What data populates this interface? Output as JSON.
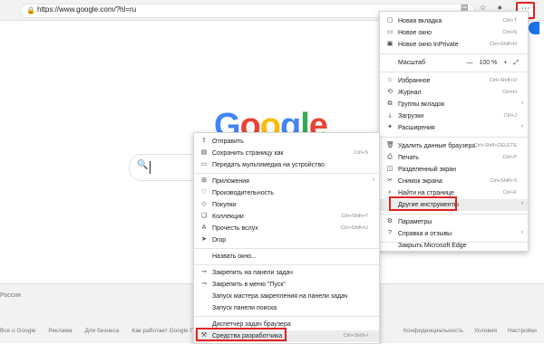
{
  "browser": {
    "url": "https://www.google.com/?hl=ru"
  },
  "page": {
    "logo": "Google",
    "footer_country": "Россия",
    "footer_links_left": [
      "Все о Google",
      "Реклама",
      "Для бизнеса",
      "Как работает Google Поиск"
    ],
    "footer_links_right": [
      "Конфиденциальность",
      "Условия",
      "Настройки"
    ]
  },
  "main_menu": {
    "items": [
      {
        "label": "Новая вкладка",
        "shortcut": "Ctrl+T",
        "icon": "new-tab-icon"
      },
      {
        "label": "Новое окно",
        "shortcut": "Ctrl+N",
        "icon": "new-window-icon"
      },
      {
        "label": "Новое окно InPrivate",
        "shortcut": "Ctrl+Shift+N",
        "icon": "inprivate-icon"
      },
      {
        "label": "Масштаб",
        "icon": "",
        "zoom": {
          "minus": "—",
          "value": "100 %",
          "plus": "+",
          "full": "⤢"
        }
      },
      {
        "label": "Избранное",
        "shortcut": "Ctrl+Shift+O",
        "icon": "star-icon"
      },
      {
        "label": "Журнал",
        "shortcut": "Ctrl+H",
        "icon": "history-icon"
      },
      {
        "label": "Группы вкладок",
        "shortcut": "",
        "icon": "tab-groups-icon",
        "arrow": "›"
      },
      {
        "label": "Загрузки",
        "shortcut": "Ctrl+J",
        "icon": "download-icon"
      },
      {
        "label": "Расширения",
        "shortcut": "",
        "icon": "extensions-icon",
        "arrow": "›"
      },
      {
        "label": "Удалить данные браузера",
        "shortcut": "Ctrl+Shift+DELETE",
        "icon": "trash-icon"
      },
      {
        "label": "Печать",
        "shortcut": "Ctrl+P",
        "icon": "print-icon"
      },
      {
        "label": "Разделенный экран",
        "shortcut": "",
        "icon": "split-screen-icon"
      },
      {
        "label": "Снимок экрана",
        "shortcut": "Ctrl+Shift+S",
        "icon": "screenshot-icon"
      },
      {
        "label": "Найти на странице",
        "shortcut": "Ctrl+F",
        "icon": "find-icon"
      },
      {
        "label": "Другие инструменты",
        "shortcut": "",
        "icon": "",
        "arrow": "›"
      },
      {
        "label": "Параметры",
        "shortcut": "",
        "icon": "settings-icon"
      },
      {
        "label": "Справка и отзывы",
        "shortcut": "",
        "icon": "help-icon",
        "arrow": "›"
      },
      {
        "label": "Закрыть Microsoft Edge",
        "shortcut": "",
        "icon": ""
      }
    ]
  },
  "sub_menu": {
    "items": [
      {
        "label": "Отправить",
        "shortcut": "",
        "icon": "share-icon"
      },
      {
        "label": "Сохранить страницу как",
        "shortcut": "Ctrl+S",
        "icon": "save-icon"
      },
      {
        "label": "Передать мультимедиа на устройство",
        "shortcut": "",
        "icon": "cast-icon"
      },
      {
        "label": "Приложения",
        "shortcut": "",
        "icon": "apps-icon",
        "arrow": "›"
      },
      {
        "label": "Производительность",
        "shortcut": "",
        "icon": "performance-icon"
      },
      {
        "label": "Покупки",
        "shortcut": "",
        "icon": "shopping-icon"
      },
      {
        "label": "Коллекции",
        "shortcut": "Ctrl+Shift+Y",
        "icon": "collections-icon"
      },
      {
        "label": "Прочесть вслух",
        "shortcut": "Ctrl+Shift+U",
        "icon": "read-aloud-icon"
      },
      {
        "label": "Drop",
        "shortcut": "",
        "icon": "drop-icon"
      },
      {
        "label": "Назвать окно...",
        "shortcut": "",
        "icon": ""
      },
      {
        "label": "Закрепить на панели задач",
        "shortcut": "",
        "icon": "pin-icon"
      },
      {
        "label": "Закрепить в меню \"Пуск\"",
        "shortcut": "",
        "icon": "pin-start-icon"
      },
      {
        "label": "Запуск мастера закрепления на панели задач",
        "shortcut": "",
        "icon": ""
      },
      {
        "label": "Запуск панели поиска",
        "shortcut": "",
        "icon": ""
      },
      {
        "label": "Диспетчер задач браузера",
        "shortcut": "",
        "icon": ""
      },
      {
        "label": "Средства разработчика",
        "shortcut": "Ctrl+Shift+I",
        "icon": "devtools-icon"
      }
    ]
  }
}
